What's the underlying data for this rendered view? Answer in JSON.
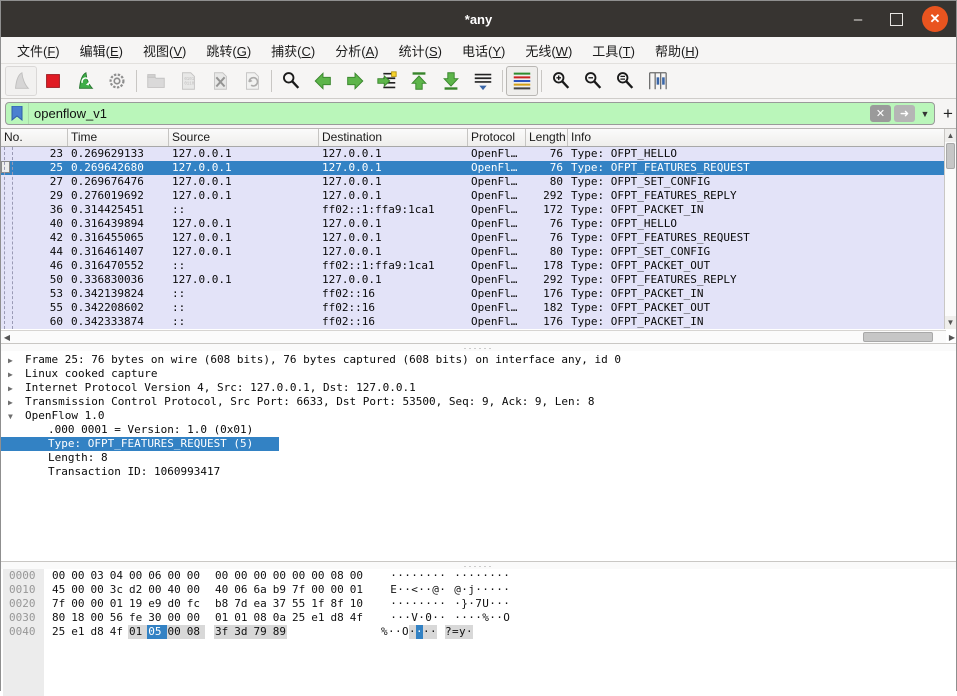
{
  "window": {
    "title": "*any",
    "controls": {
      "minimize": "–",
      "maximize": "",
      "close": "✕"
    }
  },
  "menu_bar": {
    "items": [
      {
        "label": "文件(F)"
      },
      {
        "label": "编辑(E)"
      },
      {
        "label": "视图(V)"
      },
      {
        "label": "跳转(G)"
      },
      {
        "label": "捕获(C)"
      },
      {
        "label": "分析(A)"
      },
      {
        "label": "统计(S)"
      },
      {
        "label": "电话(Y)"
      },
      {
        "label": "无线(W)"
      },
      {
        "label": "工具(T)"
      },
      {
        "label": "帮助(H)"
      }
    ]
  },
  "toolbar": {
    "buttons": [
      {
        "name": "start-capture",
        "enabled": false
      },
      {
        "name": "stop-capture",
        "enabled": true
      },
      {
        "name": "restart-capture",
        "enabled": true
      },
      {
        "name": "capture-options",
        "enabled": true
      },
      {
        "name": "open-file",
        "enabled": false
      },
      {
        "name": "save-file",
        "enabled": false
      },
      {
        "name": "close-file",
        "enabled": false
      },
      {
        "name": "reload-file",
        "enabled": false
      },
      {
        "name": "find-packet",
        "enabled": true
      },
      {
        "name": "previous-packet",
        "enabled": true
      },
      {
        "name": "next-packet",
        "enabled": true
      },
      {
        "name": "go-to-packet",
        "enabled": true
      },
      {
        "name": "first-packet",
        "enabled": true
      },
      {
        "name": "last-packet",
        "enabled": true
      },
      {
        "name": "auto-scroll",
        "enabled": true
      },
      {
        "name": "colorize-packets",
        "enabled": true,
        "active": true
      },
      {
        "name": "zoom-in",
        "enabled": true
      },
      {
        "name": "zoom-out",
        "enabled": true
      },
      {
        "name": "zoom-reset",
        "enabled": true
      },
      {
        "name": "resize-columns",
        "enabled": true
      }
    ]
  },
  "filter_bar": {
    "value": "openflow_v1",
    "clear_glyph": "✕",
    "apply_glyph": "➜",
    "caret_glyph": "▼",
    "add_button": "+"
  },
  "packet_list": {
    "columns": [
      {
        "label": "No.",
        "align": "right"
      },
      {
        "label": "Time",
        "align": "left"
      },
      {
        "label": "Source",
        "align": "left"
      },
      {
        "label": "Destination",
        "align": "left"
      },
      {
        "label": "Protocol",
        "align": "left"
      },
      {
        "label": "Length",
        "align": "right"
      },
      {
        "label": "Info",
        "align": "left"
      }
    ],
    "rows": [
      {
        "no": "23",
        "time": "0.269629133",
        "source": "127.0.0.1",
        "destination": "127.0.0.1",
        "protocol": "OpenFl…",
        "length": "76",
        "info": "Type: OFPT_HELLO",
        "selected": false
      },
      {
        "no": "25",
        "time": "0.269642680",
        "source": "127.0.0.1",
        "destination": "127.0.0.1",
        "protocol": "OpenFl…",
        "length": "76",
        "info": "Type: OFPT_FEATURES_REQUEST",
        "selected": true
      },
      {
        "no": "27",
        "time": "0.269676476",
        "source": "127.0.0.1",
        "destination": "127.0.0.1",
        "protocol": "OpenFl…",
        "length": "80",
        "info": "Type: OFPT_SET_CONFIG",
        "selected": false
      },
      {
        "no": "29",
        "time": "0.276019692",
        "source": "127.0.0.1",
        "destination": "127.0.0.1",
        "protocol": "OpenFl…",
        "length": "292",
        "info": "Type: OFPT_FEATURES_REPLY",
        "selected": false
      },
      {
        "no": "36",
        "time": "0.314425451",
        "source": "::",
        "destination": "ff02::1:ffa9:1ca1",
        "protocol": "OpenFl…",
        "length": "172",
        "info": "Type: OFPT_PACKET_IN",
        "selected": false
      },
      {
        "no": "40",
        "time": "0.316439894",
        "source": "127.0.0.1",
        "destination": "127.0.0.1",
        "protocol": "OpenFl…",
        "length": "76",
        "info": "Type: OFPT_HELLO",
        "selected": false
      },
      {
        "no": "42",
        "time": "0.316455065",
        "source": "127.0.0.1",
        "destination": "127.0.0.1",
        "protocol": "OpenFl…",
        "length": "76",
        "info": "Type: OFPT_FEATURES_REQUEST",
        "selected": false
      },
      {
        "no": "44",
        "time": "0.316461407",
        "source": "127.0.0.1",
        "destination": "127.0.0.1",
        "protocol": "OpenFl…",
        "length": "80",
        "info": "Type: OFPT_SET_CONFIG",
        "selected": false
      },
      {
        "no": "46",
        "time": "0.316470552",
        "source": "::",
        "destination": "ff02::1:ffa9:1ca1",
        "protocol": "OpenFl…",
        "length": "178",
        "info": "Type: OFPT_PACKET_OUT",
        "selected": false
      },
      {
        "no": "50",
        "time": "0.336830036",
        "source": "127.0.0.1",
        "destination": "127.0.0.1",
        "protocol": "OpenFl…",
        "length": "292",
        "info": "Type: OFPT_FEATURES_REPLY",
        "selected": false
      },
      {
        "no": "53",
        "time": "0.342139824",
        "source": "::",
        "destination": "ff02::16",
        "protocol": "OpenFl…",
        "length": "176",
        "info": "Type: OFPT_PACKET_IN",
        "selected": false
      },
      {
        "no": "55",
        "time": "0.342208602",
        "source": "::",
        "destination": "ff02::16",
        "protocol": "OpenFl…",
        "length": "182",
        "info": "Type: OFPT_PACKET_OUT",
        "selected": false
      },
      {
        "no": "60",
        "time": "0.342333874",
        "source": "::",
        "destination": "ff02::16",
        "protocol": "OpenFl…",
        "length": "176",
        "info": "Type: OFPT_PACKET_IN",
        "selected": false
      }
    ]
  },
  "detail_pane": {
    "expander_glyphs": {
      "collapsed": "▶",
      "expanded": "▼"
    },
    "rows": [
      {
        "expander": "collapsed",
        "child": false,
        "selected": false,
        "text": "Frame 25: 76 bytes on wire (608 bits), 76 bytes captured (608 bits) on interface any, id 0"
      },
      {
        "expander": "collapsed",
        "child": false,
        "selected": false,
        "text": "Linux cooked capture"
      },
      {
        "expander": "collapsed",
        "child": false,
        "selected": false,
        "text": "Internet Protocol Version 4, Src: 127.0.0.1, Dst: 127.0.0.1"
      },
      {
        "expander": "collapsed",
        "child": false,
        "selected": false,
        "text": "Transmission Control Protocol, Src Port: 6633, Dst Port: 53500, Seq: 9, Ack: 9, Len: 8"
      },
      {
        "expander": "expanded",
        "child": false,
        "selected": false,
        "text": "OpenFlow 1.0"
      },
      {
        "expander": null,
        "child": true,
        "selected": false,
        "text": ".000 0001 = Version: 1.0 (0x01)"
      },
      {
        "expander": null,
        "child": true,
        "selected": true,
        "text": "Type: OFPT_FEATURES_REQUEST (5)"
      },
      {
        "expander": null,
        "child": true,
        "selected": false,
        "text": "Length: 8"
      },
      {
        "expander": null,
        "child": true,
        "selected": false,
        "text": "Transaction ID: 1060993417"
      }
    ]
  },
  "bytes_pane": {
    "rows": [
      {
        "offset": "0000",
        "bytes": [
          "00",
          "00",
          "03",
          "04",
          "00",
          "06",
          "00",
          "00",
          "00",
          "00",
          "00",
          "00",
          "00",
          "00",
          "08",
          "00"
        ],
        "ascii": "················",
        "field_range": null,
        "selected_index": null
      },
      {
        "offset": "0010",
        "bytes": [
          "45",
          "00",
          "00",
          "3c",
          "d2",
          "00",
          "40",
          "00",
          "40",
          "06",
          "6a",
          "b9",
          "7f",
          "00",
          "00",
          "01"
        ],
        "ascii": "E··<··@·@·j·····",
        "field_range": null,
        "selected_index": null
      },
      {
        "offset": "0020",
        "bytes": [
          "7f",
          "00",
          "00",
          "01",
          "19",
          "e9",
          "d0",
          "fc",
          "b8",
          "7d",
          "ea",
          "37",
          "55",
          "1f",
          "8f",
          "10"
        ],
        "ascii": "·········}·7U···",
        "field_range": null,
        "selected_index": null
      },
      {
        "offset": "0030",
        "bytes": [
          "80",
          "18",
          "00",
          "56",
          "fe",
          "30",
          "00",
          "00",
          "01",
          "01",
          "08",
          "0a",
          "25",
          "e1",
          "d8",
          "4f"
        ],
        "ascii": "···V·0······%··O",
        "field_range": null,
        "selected_index": null
      },
      {
        "offset": "0040",
        "bytes": [
          "25",
          "e1",
          "d8",
          "4f",
          "01",
          "05",
          "00",
          "08",
          "3f",
          "3d",
          "79",
          "89"
        ],
        "ascii": "%··O····?=y·",
        "field_range": [
          4,
          11
        ],
        "selected_index": 5
      }
    ]
  },
  "colors": {
    "titlebar_bg": "#373431",
    "close_button": "#E9541F",
    "filter_valid_bg": "#baf6ba",
    "packet_row_bg": "#e3e3f8",
    "selection_blue": "#3382c4",
    "field_highlight_gray": "#d8d8d8"
  }
}
